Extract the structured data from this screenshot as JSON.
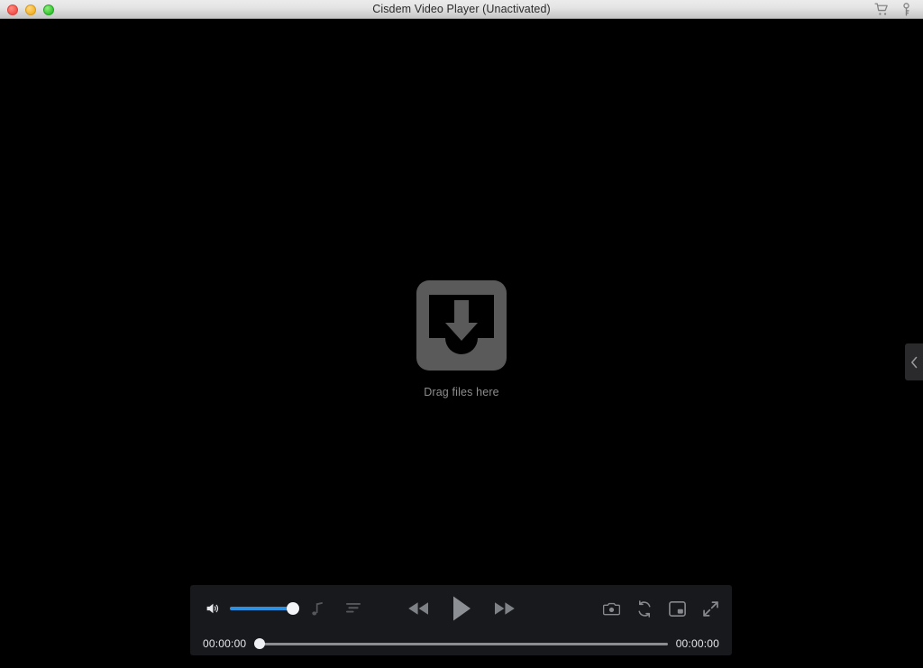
{
  "window": {
    "title": "Cisdem Video Player (Unactivated)",
    "traffic_lights": [
      {
        "name": "close",
        "color": "#f2534a"
      },
      {
        "name": "minimize",
        "color": "#f4b429"
      },
      {
        "name": "maximize",
        "color": "#34c632"
      }
    ],
    "actions": [
      {
        "name": "cart-icon",
        "label": "Buy"
      },
      {
        "name": "key-icon",
        "label": "Register"
      }
    ]
  },
  "video_area": {
    "background_color": "#000000",
    "drop_zone": {
      "icon": "download-inbox-icon",
      "label": "Drag files here",
      "icon_color": "#5a5a5a",
      "label_color": "#8d8d8d"
    }
  },
  "sidebar_toggle": {
    "icon": "chevron-left-icon",
    "tooltip": "Show playlist"
  },
  "controls": {
    "accent_color": "#2e90e0",
    "bar_color": "#18191d",
    "left": [
      {
        "name": "volume-button",
        "icon": "speaker-icon",
        "label": "Volume"
      },
      {
        "name": "audio-track-button",
        "icon": "music-note-icon",
        "label": "Audio track"
      },
      {
        "name": "subtitle-button",
        "icon": "subtitles-icon",
        "label": "Subtitles"
      }
    ],
    "volume": {
      "value": 100,
      "min": 0,
      "max": 100
    },
    "center": [
      {
        "name": "rewind-button",
        "icon": "rewind-icon",
        "label": "Rewind"
      },
      {
        "name": "play-button",
        "icon": "play-icon",
        "label": "Play"
      },
      {
        "name": "fast-forward-button",
        "icon": "fast-forward-icon",
        "label": "Fast forward"
      }
    ],
    "right": [
      {
        "name": "snapshot-button",
        "icon": "camera-icon",
        "label": "Snapshot"
      },
      {
        "name": "loop-button",
        "icon": "loop-icon",
        "label": "Loop"
      },
      {
        "name": "picture-in-picture-button",
        "icon": "picture-in-picture-icon",
        "label": "Picture in picture"
      },
      {
        "name": "fullscreen-button",
        "icon": "expand-icon",
        "label": "Full screen"
      }
    ],
    "progress": {
      "current_time": "00:00:00",
      "total_time": "00:00:00",
      "value": 0
    }
  }
}
